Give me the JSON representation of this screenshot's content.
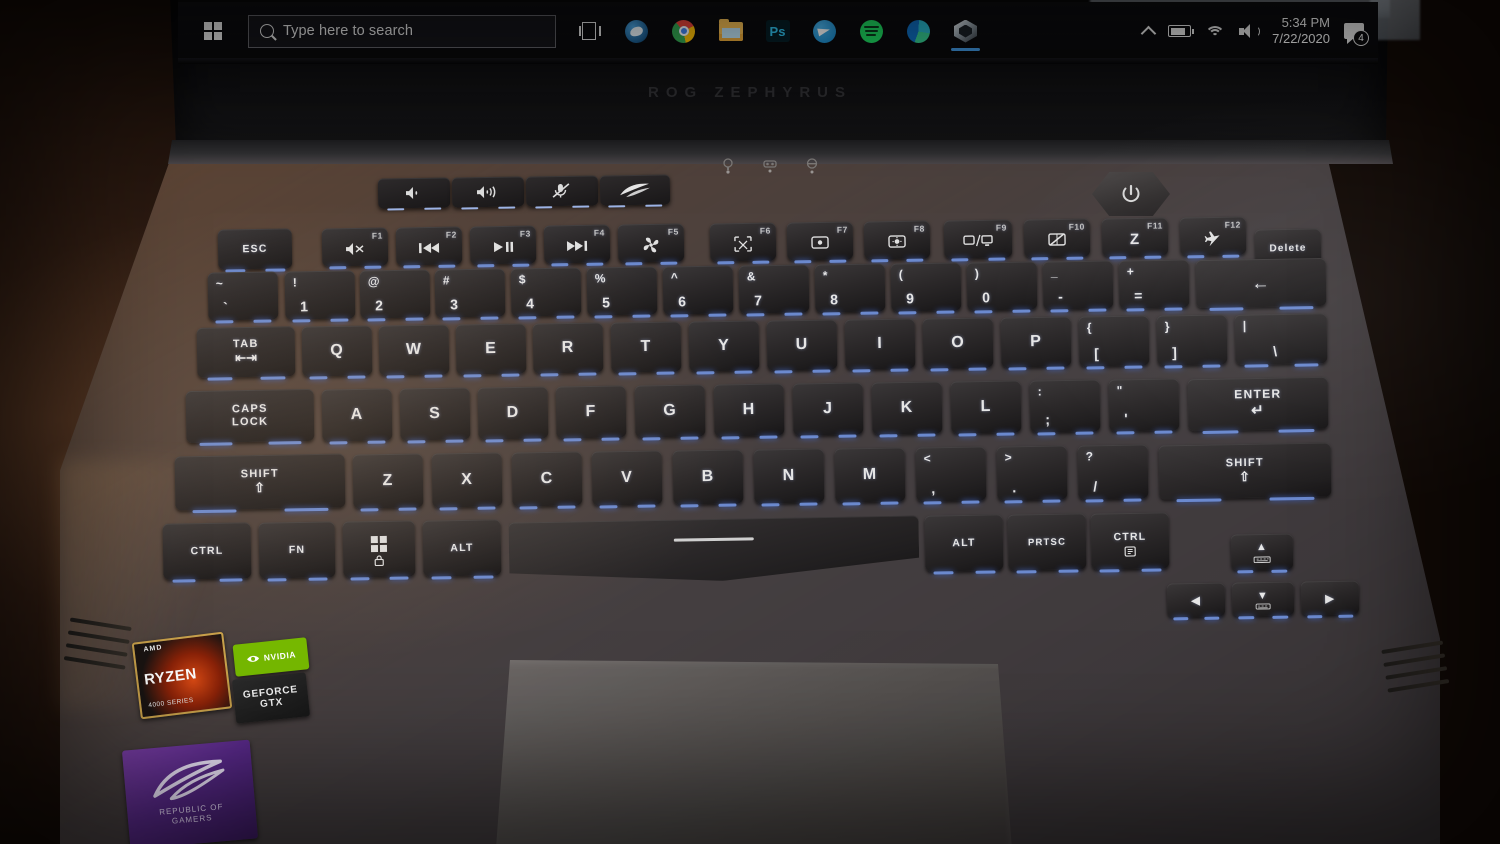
{
  "taskbar": {
    "start_label": "Start",
    "search_placeholder": "Type here to search",
    "search_value": "",
    "taskview_label": "Task View",
    "apps": [
      {
        "name": "steam",
        "label": "Steam",
        "active": false
      },
      {
        "name": "chrome",
        "label": "Google Chrome",
        "active": false
      },
      {
        "name": "file-explorer",
        "label": "File Explorer",
        "active": false
      },
      {
        "name": "photoshop",
        "label": "Ps",
        "active": false
      },
      {
        "name": "telegram",
        "label": "Telegram",
        "active": false
      },
      {
        "name": "spotify",
        "label": "Spotify",
        "active": false
      },
      {
        "name": "edge",
        "label": "Microsoft Edge",
        "active": false
      },
      {
        "name": "armoury-crate",
        "label": "Armoury Crate",
        "active": true
      }
    ],
    "tray": {
      "overflow_label": "Show hidden icons",
      "battery_label": "Battery",
      "network_label": "Network",
      "volume_label": "Volume",
      "time": "5:34 PM",
      "date": "7/22/2020",
      "notifications_count": "4"
    }
  },
  "lid": {
    "brand": "ROG ZEPHYRUS"
  },
  "deck": {
    "power_label": "Power",
    "indicators": [
      "power-led",
      "battery-led",
      "caps-lock-led"
    ],
    "media_buttons": [
      {
        "name": "volume-down-button",
        "label": "Volume Down"
      },
      {
        "name": "volume-up-button",
        "label": "Volume Up"
      },
      {
        "name": "mic-mute-button",
        "label": "Microphone Mute"
      },
      {
        "name": "rog-button",
        "label": "ROG"
      }
    ],
    "touchpad_label": "Touchpad"
  },
  "stickers": {
    "ryzen": {
      "brand": "AMD",
      "model": "RYZEN",
      "gen": "4000 SERIES"
    },
    "nvidia": {
      "brand": "NVIDIA",
      "line1": "GEFORCE",
      "line2": "GTX"
    },
    "rog": {
      "line1": "REPUBLIC OF",
      "line2": "GAMERS"
    }
  },
  "keyboard": {
    "function_row": [
      {
        "name": "esc",
        "label": "ESC"
      },
      {
        "name": "f1",
        "fn": "F1",
        "icon": "mute-icon"
      },
      {
        "name": "f2",
        "fn": "F2",
        "icon": "previous-track-icon"
      },
      {
        "name": "f3",
        "fn": "F3",
        "icon": "play-pause-icon"
      },
      {
        "name": "f4",
        "fn": "F4",
        "icon": "next-track-icon"
      },
      {
        "name": "f5",
        "fn": "F5",
        "icon": "fan-icon"
      },
      {
        "name": "f6",
        "fn": "F6",
        "icon": "snip-icon"
      },
      {
        "name": "f7",
        "fn": "F7",
        "icon": "brightness-down-icon"
      },
      {
        "name": "f8",
        "fn": "F8",
        "icon": "brightness-up-icon"
      },
      {
        "name": "f9",
        "fn": "F9",
        "icon": "display-switch-icon"
      },
      {
        "name": "f10",
        "fn": "F10",
        "icon": "touchpad-toggle-icon"
      },
      {
        "name": "f11",
        "fn": "F11",
        "icon": "sleep-icon",
        "label": "Z"
      },
      {
        "name": "f12",
        "fn": "F12",
        "icon": "airplane-mode-icon"
      },
      {
        "name": "delete",
        "label": "Delete"
      }
    ],
    "number_row": [
      {
        "name": "backtick",
        "upper": "~",
        "lower": "`"
      },
      {
        "name": "one",
        "upper": "!",
        "lower": "1"
      },
      {
        "name": "two",
        "upper": "@",
        "lower": "2"
      },
      {
        "name": "three",
        "upper": "#",
        "lower": "3"
      },
      {
        "name": "four",
        "upper": "$",
        "lower": "4"
      },
      {
        "name": "five",
        "upper": "%",
        "lower": "5"
      },
      {
        "name": "six",
        "upper": "^",
        "lower": "6"
      },
      {
        "name": "seven",
        "upper": "&",
        "lower": "7"
      },
      {
        "name": "eight",
        "upper": "*",
        "lower": "8"
      },
      {
        "name": "nine",
        "upper": "(",
        "lower": "9"
      },
      {
        "name": "zero",
        "upper": ")",
        "lower": "0"
      },
      {
        "name": "minus",
        "upper": "_",
        "lower": "-"
      },
      {
        "name": "equals",
        "upper": "+",
        "lower": "="
      },
      {
        "name": "backspace",
        "label": "←"
      }
    ],
    "top_row": [
      {
        "name": "tab",
        "label": "TAB"
      },
      {
        "name": "q",
        "label": "Q"
      },
      {
        "name": "w",
        "label": "W"
      },
      {
        "name": "e",
        "label": "E"
      },
      {
        "name": "r",
        "label": "R"
      },
      {
        "name": "t",
        "label": "T"
      },
      {
        "name": "y",
        "label": "Y"
      },
      {
        "name": "u",
        "label": "U"
      },
      {
        "name": "i",
        "label": "I"
      },
      {
        "name": "o",
        "label": "O"
      },
      {
        "name": "p",
        "label": "P"
      },
      {
        "name": "bracket-left",
        "upper": "{",
        "lower": "["
      },
      {
        "name": "bracket-right",
        "upper": "}",
        "lower": "]"
      },
      {
        "name": "backslash",
        "upper": "|",
        "lower": "\\"
      }
    ],
    "home_row": [
      {
        "name": "caps-lock",
        "label1": "CAPS",
        "label2": "LOCK"
      },
      {
        "name": "a",
        "label": "A"
      },
      {
        "name": "s",
        "label": "S"
      },
      {
        "name": "d",
        "label": "D"
      },
      {
        "name": "f",
        "label": "F"
      },
      {
        "name": "g",
        "label": "G"
      },
      {
        "name": "h",
        "label": "H"
      },
      {
        "name": "j",
        "label": "J"
      },
      {
        "name": "k",
        "label": "K"
      },
      {
        "name": "l",
        "label": "L"
      },
      {
        "name": "semicolon",
        "upper": ":",
        "lower": ";"
      },
      {
        "name": "quote",
        "upper": "\"",
        "lower": "'"
      },
      {
        "name": "enter",
        "label": "ENTER"
      }
    ],
    "bottom_letter_row": [
      {
        "name": "shift-left",
        "label": "SHIFT"
      },
      {
        "name": "z",
        "label": "Z"
      },
      {
        "name": "x",
        "label": "X"
      },
      {
        "name": "c",
        "label": "C"
      },
      {
        "name": "v",
        "label": "V"
      },
      {
        "name": "b",
        "label": "B"
      },
      {
        "name": "n",
        "label": "N"
      },
      {
        "name": "m",
        "label": "M"
      },
      {
        "name": "comma",
        "upper": "<",
        "lower": ","
      },
      {
        "name": "period",
        "upper": ">",
        "lower": "."
      },
      {
        "name": "slash",
        "upper": "?",
        "lower": "/"
      },
      {
        "name": "shift-right",
        "label": "SHIFT"
      }
    ],
    "modifier_row": [
      {
        "name": "ctrl-left",
        "label": "CTRL"
      },
      {
        "name": "fn",
        "label": "FN"
      },
      {
        "name": "windows",
        "icon": "windows-icon"
      },
      {
        "name": "alt-left",
        "label": "ALT"
      },
      {
        "name": "space",
        "label": ""
      },
      {
        "name": "alt-right",
        "label": "ALT"
      },
      {
        "name": "prtsc",
        "label": "PRTSC"
      },
      {
        "name": "ctrl-right",
        "label": "CTRL"
      }
    ],
    "arrow_keys": [
      {
        "name": "arrow-up",
        "label": "▲"
      },
      {
        "name": "arrow-left",
        "label": "◀"
      },
      {
        "name": "arrow-down",
        "label": "▼"
      },
      {
        "name": "arrow-right",
        "label": "▶"
      }
    ]
  }
}
